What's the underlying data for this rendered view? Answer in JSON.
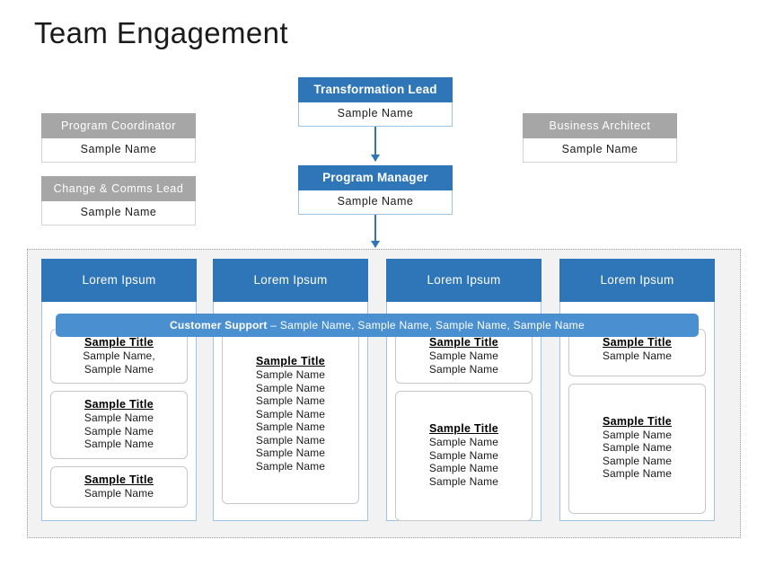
{
  "page": {
    "title": "Team Engagement",
    "accent_blue": "#2E76B8",
    "banner_blue": "#4A90D0",
    "gray": "#A6A6A6",
    "panel_bg": "#F2F2F2"
  },
  "org": {
    "transformation_lead": {
      "role": "Transformation Lead",
      "name": "Sample Name"
    },
    "program_manager": {
      "role": "Program Manager",
      "name": "Sample Name"
    },
    "program_coordinator": {
      "role": "Program  Coordinator",
      "name": "Sample  Name"
    },
    "change_comms_lead": {
      "role": "Change  &  Comms  Lead",
      "name": "Sample  Name"
    },
    "business_architect": {
      "role": "Business  Architect",
      "name": "Sample  Name"
    }
  },
  "support_banner": {
    "title": "Customer Support",
    "names": " –  Sample  Name,  Sample  Name,  Sample  Name,  Sample  Name"
  },
  "columns": [
    {
      "header": "Lorem Ipsum",
      "cards": [
        {
          "title": "Sample  Title",
          "lines": [
            "Sample Name,",
            "Sample Name"
          ]
        },
        {
          "title": "Sample  Title",
          "lines": [
            "Sample Name",
            "Sample Name",
            "Sample Name"
          ]
        },
        {
          "title": "Sample  Title",
          "lines": [
            "Sample Name"
          ]
        }
      ]
    },
    {
      "header": "Lorem Ipsum",
      "cards": [
        {
          "title": "Sample  Title",
          "lines": [
            "Sample Name",
            "Sample Name",
            "Sample Name",
            "Sample Name",
            "Sample Name",
            "Sample Name",
            "Sample Name",
            "Sample Name"
          ]
        }
      ]
    },
    {
      "header": "Lorem Ipsum",
      "cards": [
        {
          "title": "Sample  Title",
          "lines": [
            "Sample Name",
            "Sample Name"
          ]
        },
        {
          "title": "Sample  Title",
          "lines": [
            "Sample Name",
            "Sample Name",
            "Sample Name",
            "Sample Name"
          ]
        }
      ]
    },
    {
      "header": "Lorem Ipsum",
      "cards": [
        {
          "title": "Sample  Title",
          "lines": [
            "Sample Name"
          ]
        },
        {
          "title": "Sample  Title",
          "lines": [
            "Sample Name",
            "Sample Name",
            "Sample Name",
            "Sample Name"
          ]
        }
      ]
    }
  ]
}
